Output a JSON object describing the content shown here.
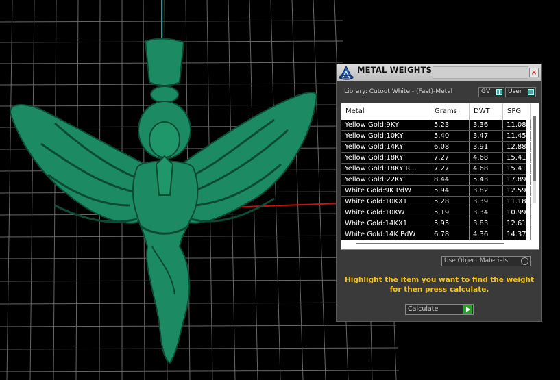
{
  "dialog": {
    "title": "METAL WEIGHTS",
    "close_glyph": "×",
    "library_label": "Library: Cutout White - (Fast)-Metal",
    "gv_label": "GV",
    "user_label": "User",
    "use_object_materials": "Use Object Materials",
    "hint": "Highlight the item you want to find the weight for then press calculate.",
    "calculate_label": "Calculate"
  },
  "table": {
    "headers": [
      "Metal",
      "Grams",
      "DWT",
      "SPG"
    ],
    "rows": [
      [
        "Yellow Gold:9KY",
        "5.23",
        "3.36",
        "11.08"
      ],
      [
        "Yellow Gold:10KY",
        "5.40",
        "3.47",
        "11.45"
      ],
      [
        "Yellow Gold:14KY",
        "6.08",
        "3.91",
        "12.88"
      ],
      [
        "Yellow Gold:18KY",
        "7.27",
        "4.68",
        "15.41"
      ],
      [
        "Yellow Gold:18KY R...",
        "7.27",
        "4.68",
        "15.41"
      ],
      [
        "Yellow Gold:22KY",
        "8.44",
        "5.43",
        "17.89"
      ],
      [
        "White Gold:9K PdW",
        "5.94",
        "3.82",
        "12.59"
      ],
      [
        "White Gold:10KX1",
        "5.28",
        "3.39",
        "11.18"
      ],
      [
        "White Gold:10KW",
        "5.19",
        "3.34",
        "10.99"
      ],
      [
        "White Gold:14KX1",
        "5.95",
        "3.83",
        "12.61"
      ],
      [
        "White Gold:14K PdW",
        "6.78",
        "4.36",
        "14.37"
      ]
    ]
  },
  "colors": {
    "model_green": "#1c8a62",
    "hint_yellow": "#f2c21b",
    "grid": "#6a6a6a",
    "axis_red": "#cc1111",
    "axis_cyan": "#15a3a3"
  },
  "icons": {
    "app": "app-logo-icon",
    "close": "close-icon",
    "calculate": "play-icon"
  }
}
